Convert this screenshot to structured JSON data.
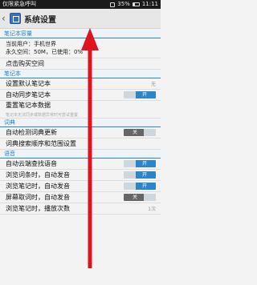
{
  "status": {
    "left": "仅限紧急呼叫",
    "battery": "35%",
    "time": "11:11"
  },
  "appbar": {
    "back": "‹",
    "title": "系统设置"
  },
  "sections": {
    "account": {
      "header": "笔记本容量",
      "user_label": "当前用户：手机世界",
      "space_label": "永久空间：50M，已使用：0%",
      "purchase": "点击购买空间"
    },
    "notebook": {
      "header": "笔记本",
      "default_notebook": {
        "label": "设置默认笔记本",
        "value": "无"
      },
      "auto_sync": {
        "label": "自动同步笔记本",
        "toggle": "开"
      },
      "rebuild": {
        "label": "重置笔记本数据",
        "sub": "笔记本无法同步或数据异常时可尝试重置"
      }
    },
    "dictionary": {
      "header": "词典",
      "auto_update": {
        "label": "自动检测词典更新",
        "toggle": "关"
      },
      "search_order": {
        "label": "词典搜索顺序和范围设置"
      }
    },
    "voice": {
      "header": "语音",
      "cloud_voice": {
        "label": "自动云端查找语音",
        "toggle": "开"
      },
      "browse_words": {
        "label": "浏览词条时，自动发音",
        "toggle": "开"
      },
      "browse_notes": {
        "label": "浏览笔记时，自动发音",
        "toggle": "开"
      },
      "screen_words": {
        "label": "屏幕取词时，自动发音",
        "toggle": "关"
      },
      "browse_more": {
        "label": "浏览笔记时，播放次数",
        "value": "1次"
      }
    }
  },
  "colors": {
    "accent": "#2c84c9",
    "arrow": "#e0141e"
  }
}
